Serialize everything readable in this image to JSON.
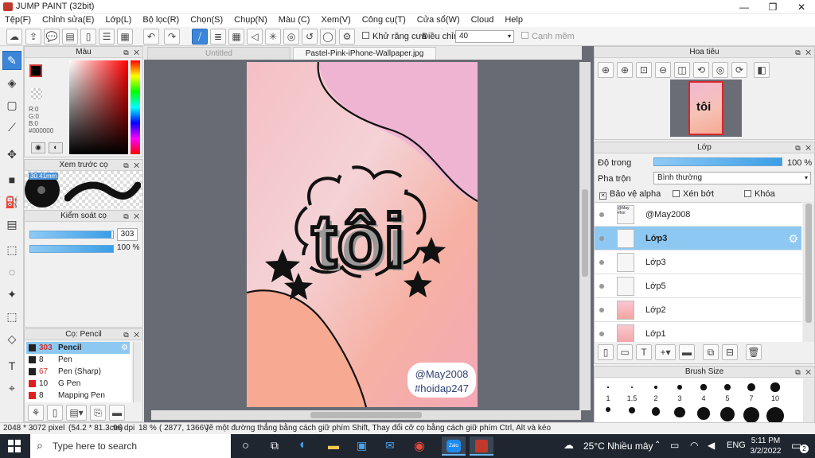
{
  "window": {
    "title": "JUMP PAINT (32bit)",
    "minimize": "—",
    "maximize": "❐",
    "close": "✕"
  },
  "menu": [
    "Tệp(F)",
    "Chỉnh sửa(E)",
    "Lớp(L)",
    "Bộ lọc(R)",
    "Chọn(S)",
    "Chụp(N)",
    "Màu (C)",
    "Xem(V)",
    "Công cụ(T)",
    "Cửa sổ(W)",
    "Cloud",
    "Help"
  ],
  "toolbar": {
    "antialias_label": "Khử răng cưa",
    "adjust_label": "Điều chỉnh",
    "adjust_value": "40",
    "edge_label": "Cạnh mềm"
  },
  "color_panel": {
    "title": "Màu",
    "r": "R:0",
    "g": "G:0",
    "b": "B:0",
    "hex": "#000000",
    "primary": "#000000",
    "secondary": "#ffffff"
  },
  "brush_preview": {
    "title": "Xem trước cọ",
    "size_label": "30.41mm"
  },
  "brush_control": {
    "title": "Kiểm soát cọ",
    "size_value": "303",
    "opacity_value": "100 %",
    "size_fraction": 0.98,
    "opacity_fraction": 1.0
  },
  "brush_list": {
    "title": "Cọ: Pencil",
    "items": [
      {
        "size": "303",
        "name": "Pencil",
        "color": "#222222"
      },
      {
        "size": "8",
        "name": "Pen",
        "color": "#222222"
      },
      {
        "size": "67",
        "name": "Pen (Sharp)",
        "color": "#222222"
      },
      {
        "size": "10",
        "name": "G Pen",
        "color": "#e02020"
      },
      {
        "size": "8",
        "name": "Mapping Pen",
        "color": "#e02020"
      }
    ]
  },
  "tabs": [
    {
      "label": "Untitled"
    },
    {
      "label": "Pastel-Pink-iPhone-Wallpaper.jpg"
    }
  ],
  "artwork": {
    "text_main": "tôi",
    "handle_line1": "@May2008",
    "handle_line2": "#hoidap247"
  },
  "navigator": {
    "title": "Hoa tiêu"
  },
  "layers_panel": {
    "title": "Lớp",
    "opacity_label": "Độ trong",
    "opacity_value": "100 %",
    "blend_label": "Pha trộn",
    "blend_value": "Bình thường",
    "protect_alpha": "Bảo vệ alpha",
    "clip": "Xén bớt",
    "lock": "Khóa",
    "opacity_fraction": 1.0,
    "layers": [
      {
        "name": "@May2008"
      },
      {
        "name": "Lớp3"
      },
      {
        "name": "Lớp3"
      },
      {
        "name": "Lớp5"
      },
      {
        "name": "Lớp2"
      },
      {
        "name": "Lớp1"
      }
    ]
  },
  "brush_size_panel": {
    "title": "Brush Size",
    "sizes": [
      "1",
      "1.5",
      "2",
      "3",
      "4",
      "5",
      "7",
      "10"
    ]
  },
  "status": {
    "dimensions": "2048 * 3072 pixel",
    "physical": "(54.2 * 81.3cm)",
    "dpi": "96 dpi",
    "zoom": "18 %",
    "coords": "( 2877, 1366 )",
    "hint": "Vẽ một đường thẳng bằng cách giữ phím Shift, Thay đổi cỡ cọ bằng cách giữ phím Ctrl, Alt và kéo"
  },
  "taskbar": {
    "search_placeholder": "Type here to search",
    "weather": "25°C  Nhiều mây",
    "lang": "ENG",
    "time": "5:11 PM",
    "date": "3/2/2022",
    "notif_count": "2"
  }
}
